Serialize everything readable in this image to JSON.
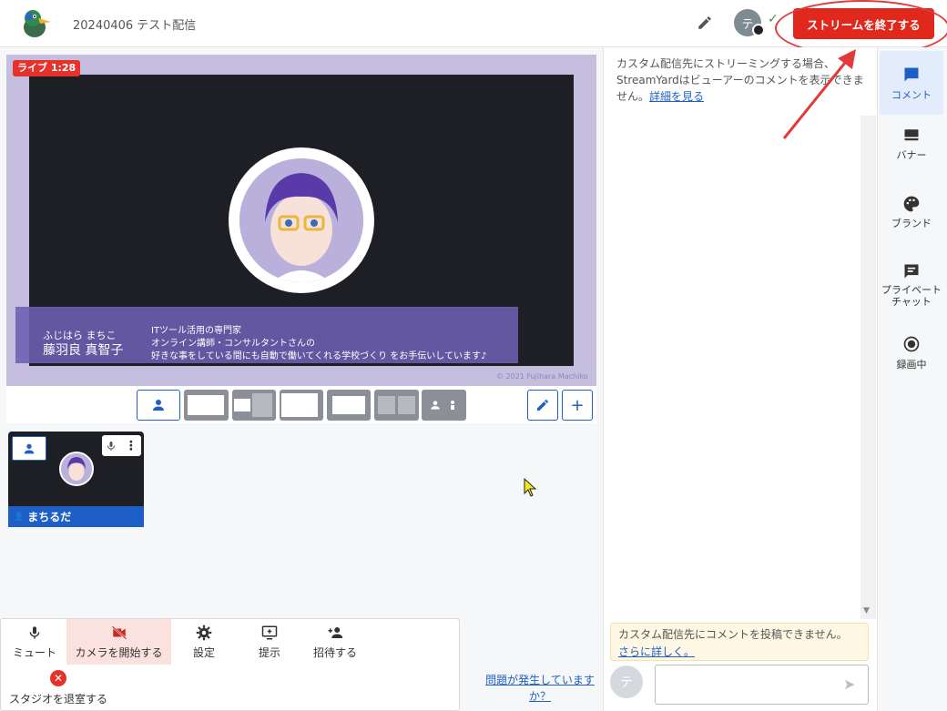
{
  "header": {
    "title": "20240406 テスト配信",
    "avatar_initial": "テ",
    "end_stream_label": "ストリームを終了する"
  },
  "stage": {
    "live_label": "ライブ 1:28",
    "lower_third": {
      "ruby": "ふじはら まちこ",
      "name": "藤羽良 真智子",
      "line1": "ITツール活用の専門家",
      "line2": "オンライン講師・コンサルタントさんの",
      "line3": "好きな事をしている間にも自動で働いてくれる学校づくり をお手伝いしています♪"
    },
    "copyright": "© 2021 Fujihara Machiko"
  },
  "participant": {
    "name": "まちるだ"
  },
  "toolbar": {
    "mute": "ミュート",
    "camera": "カメラを開始する",
    "settings": "設定",
    "present": "提示",
    "invite": "招待する",
    "leave": "スタジオを退室する",
    "problem_link": "問題が発生していますか？"
  },
  "comments": {
    "notice_text": "カスタム配信先にストリーミングする場合、StreamYardはビューアーのコメントを表示できません。",
    "notice_link": "詳細を見る",
    "warn_text": "カスタム配信先にコメントを投稿できません。",
    "warn_link": "さらに詳しく。",
    "chat_avatar_initial": "テ"
  },
  "sidenav": {
    "comments": "コメント",
    "banner": "バナー",
    "brand": "ブランド",
    "private_chat": "プライベートチャット",
    "recording": "録画中"
  },
  "colors": {
    "end_button": "#e0291c",
    "accent_blue": "#1e5fc7",
    "stage_bg": "#c6bedf",
    "lower_third": "#6c60b2"
  }
}
